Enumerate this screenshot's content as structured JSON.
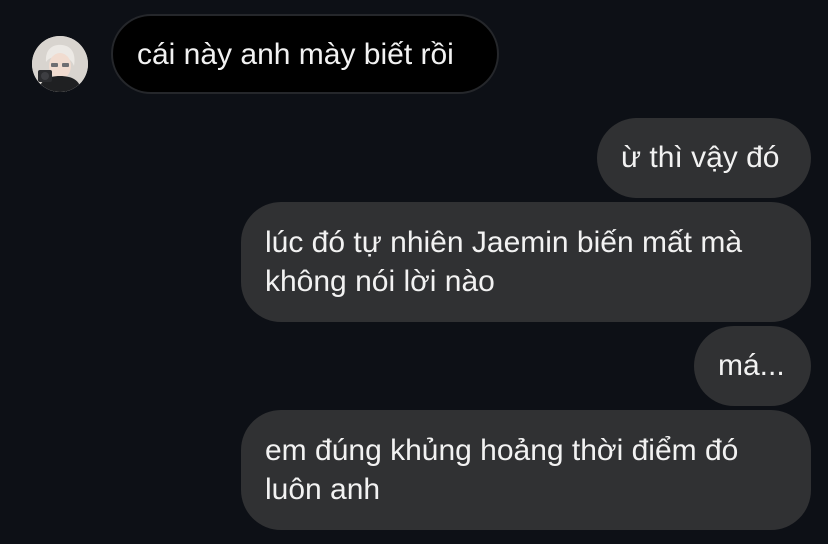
{
  "contact": {
    "avatar_icon": "user-avatar"
  },
  "messages": [
    {
      "direction": "incoming",
      "lines": [
        "cái này anh mày biết rồi"
      ]
    },
    {
      "direction": "outgoing",
      "lines": [
        "ừ thì vậy đó"
      ]
    },
    {
      "direction": "outgoing",
      "lines": [
        "lúc đó tự nhiên Jaemin biến mất mà",
        "không nói lời nào"
      ]
    },
    {
      "direction": "outgoing",
      "lines": [
        "má..."
      ]
    },
    {
      "direction": "outgoing",
      "lines": [
        "em đúng khủng hoảng thời điểm đó",
        "luôn anh"
      ]
    }
  ],
  "colors": {
    "background": "#0d1016",
    "incoming_bubble": "#000000",
    "outgoing_bubble": "#303133",
    "text": "#f2f2f2"
  }
}
